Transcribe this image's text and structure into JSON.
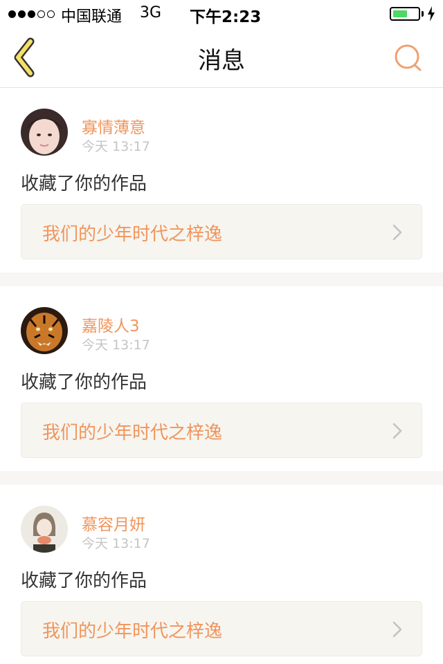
{
  "status_bar": {
    "signal_dots_filled": 3,
    "signal_dots_total": 5,
    "carrier": "中国联通",
    "network": "3G",
    "time": "下午2:23",
    "battery_level": 0.55,
    "battery_color": "#4cd964"
  },
  "nav": {
    "title": "消息",
    "back_icon": "chevron-left-icon",
    "search_icon": "search-icon",
    "accent_color": "#f0955c"
  },
  "messages": [
    {
      "username": "寡情薄意",
      "time": "今天 13:17",
      "action": "收藏了你的作品",
      "work_title": "我们的少年时代之梓逸"
    },
    {
      "username": "嘉陵人3",
      "time": "今天 13:17",
      "action": "收藏了你的作品",
      "work_title": "我们的少年时代之梓逸"
    },
    {
      "username": "慕容月妍",
      "time": "今天 13:17",
      "action": "收藏了你的作品",
      "work_title": "我们的少年时代之梓逸"
    }
  ]
}
